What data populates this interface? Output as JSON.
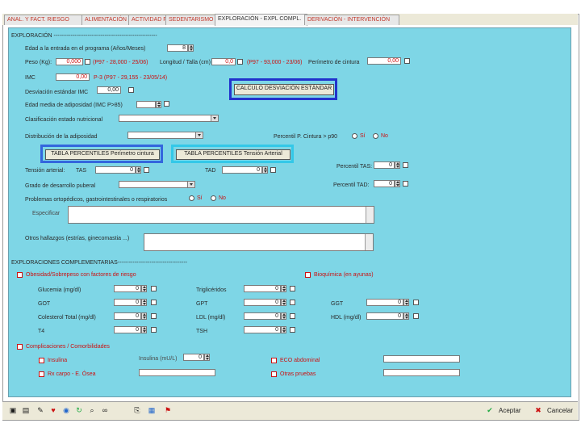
{
  "tabs": [
    "ANAL. Y FACT. RIESGO",
    "ALIMENTACIÓN",
    "ACTIVIDAD FÍSICA",
    "SEDENTARISMO",
    "EXPLORACIÓN - EXPL COMPL.",
    "DERIVACIÓN - INTERVENCIÓN"
  ],
  "exploracion": {
    "header": "EXPLORACIÓN -------------------------------------------------------",
    "edad_label": "Edad a la entrada en el programa (Años/Meses)",
    "edad_value": "8",
    "peso_label": "Peso (Kg):",
    "peso_value": "0,000",
    "peso_ref": "(P97 - 28,000 - 25/06)",
    "longitud_label": "Longitud / Talla (cm)",
    "longitud_value": "0,0",
    "longitud_ref": "(P97 - 93,000 - 23/06)",
    "perimetro_label": "Perímetro de cintura",
    "perimetro_value": "0,00",
    "imc_label": "IMC",
    "imc_value": "0,00",
    "imc_ref": "P-3 (P97 - 29,155 - 23/05/14)",
    "desv_label": "Desviación estándar IMC",
    "desv_value": "0,00",
    "calc_button": "CALCULO DESVIACIÓN ESTÁNDAR",
    "edad_media_label": "Edad media de adiposidad (IMC P>85)",
    "clasif_label": "Clasificación estado nutricional",
    "distrib_label": "Distribución de la adiposidad",
    "percentil_label": "Percentil P. Cintura > p90",
    "si_label": "Sí",
    "no_label": "No",
    "tabla_perimetro_button": "TABLA PERCENTILES Perímetro cintura",
    "tabla_tension_button": "TABLA PERCENTILES Tensión Arterial",
    "tension_label": "Tensión arterial:",
    "tas_label": "TAS",
    "tas_value": "0",
    "tad_label": "TAD",
    "tad_value": "0",
    "percentil_tas_label": "Percentil TAS:",
    "percentil_tas_value": "0",
    "grado_label": "Grado de desarrollo puberal",
    "percentil_tad_label": "Percentil TAD:",
    "percentil_tad_value": "0",
    "problemas_label": "Problemas ortopédicos, gastrointestinales o respiratorios",
    "problemas_si": "Sí",
    "problemas_no": "No",
    "especificar_label": "Especificar",
    "otros_label": "Otros hallazgos (estrías, ginecomastia ...)"
  },
  "complementarias": {
    "header": "EXPLORACIONES COMPLEMENTARIAS-------------------------------------",
    "obesidad_label": "Obesidad/Sobrepeso con factores de riesgo",
    "bioquimica_label": "Bioquímica (en ayunas)",
    "glucemia_label": "Glucemia (mg/dl)",
    "glucemia_value": "0",
    "trigliceridos_label": "Triglicéridos",
    "trigliceridos_value": "0",
    "got_label": "GOT",
    "got_value": "0",
    "gpt_label": "GPT",
    "gpt_value": "0",
    "ggt_label": "GGT",
    "ggt_value": "0",
    "colesterol_label": "Colesterol Total (mg/dl)",
    "colesterol_value": "0",
    "ldl_label": "LDL (mg/dl)",
    "ldl_value": "0",
    "hdl_label": "HDL (mg/dl)",
    "hdl_value": "0",
    "t4_label": "T4",
    "t4_value": "0",
    "tsh_label": "TSH",
    "tsh_value": "0",
    "comorbilidades_label": "Complicaciones / Comorbilidades",
    "insulina_label": "Insulina",
    "insulina_field_label": "Insulina (mU/L)",
    "insulina_value": "0",
    "eco_label": "ECO abdominal",
    "rx_label": "Rx carpo - E. Ósea",
    "otras_label": "Otras pruebas"
  },
  "bottom": {
    "aceptar": "Aceptar",
    "cancelar": "Cancelar"
  },
  "colors": {
    "panel": "#7ed6e6",
    "calc_frame": "#2233cc",
    "perimetro_frame": "#3366dd",
    "tension_frame": "#33c8e8",
    "required": "#cc1111"
  }
}
